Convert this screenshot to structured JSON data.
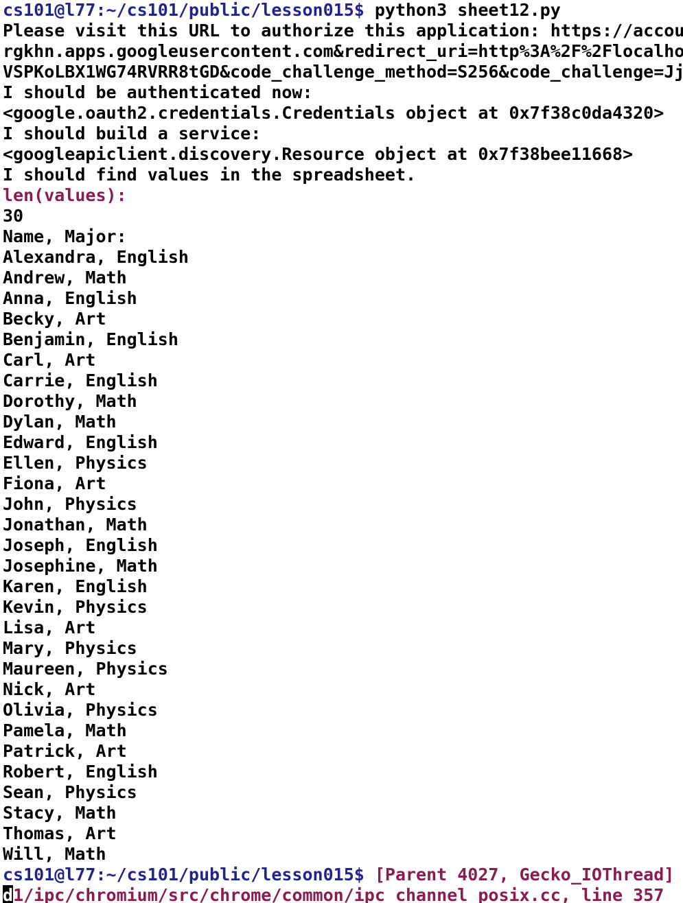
{
  "colors": {
    "background": "#ffffff",
    "text": "#000000",
    "prompt": "#23238f",
    "highlight": "#8a1c50"
  },
  "prompt": "cs101@l77:~/cs101/public/lesson015$",
  "command": " python3 sheet12.py",
  "output": {
    "auth_line_1": "Please visit this URL to authorize this application: https://accou",
    "auth_line_2": "rgkhn.apps.googleusercontent.com&redirect_uri=http%3A%2F%2Flocalho",
    "auth_line_3": "VSPKoLBX1WG74RVRR8tGD&code_challenge_method=S256&code_challenge=Jj",
    "authenticated_msg": "I should be authenticated now:",
    "credentials_obj": "<google.oauth2.credentials.Credentials object at 0x7f38c0da4320>",
    "build_service_msg": "I should build a service:",
    "resource_obj": "<googleapiclient.discovery.Resource object at 0x7f38bee11668>",
    "find_values_msg": "I should find values in the spreadsheet.",
    "len_label": "len(values):",
    "len_value": "30",
    "header": "Name, Major:",
    "rows": [
      "Alexandra, English",
      "Andrew, Math",
      "Anna, English",
      "Becky, Art",
      "Benjamin, English",
      "Carl, Art",
      "Carrie, English",
      "Dorothy, Math",
      "Dylan, Math",
      "Edward, English",
      "Ellen, Physics",
      "Fiona, Art",
      "John, Physics",
      "Jonathan, Math",
      "Joseph, English",
      "Josephine, Math",
      "Karen, English",
      "Kevin, Physics",
      "Lisa, Art",
      "Mary, Physics",
      "Maureen, Physics",
      "Nick, Art",
      "Olivia, Physics",
      "Pamela, Math",
      "Patrick, Art",
      "Robert, English",
      "Sean, Physics",
      "Stacy, Math",
      "Thomas, Art",
      "Will, Math"
    ]
  },
  "final_prompt": "cs101@l77:~/cs101/public/lesson015$",
  "gecko_message": " [Parent 4027, Gecko_IOThread] ",
  "gecko_message_2": "1/ipc/chromium/src/chrome/common/ipc_channel_posix.cc, line 357",
  "cursor_char": "d"
}
